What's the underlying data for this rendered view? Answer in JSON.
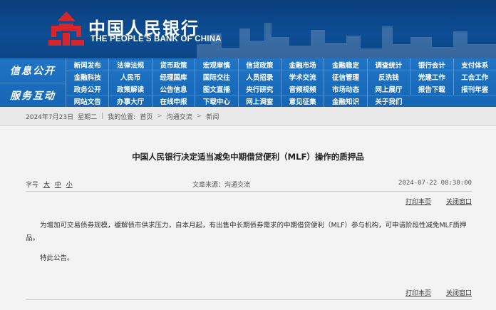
{
  "header": {
    "brand_cn": "中国人民银行",
    "brand_en": "THE PEOPLE'S BANK OF CHINA"
  },
  "nav": {
    "section1": "信息公开",
    "section2": "服务互动",
    "rows": [
      [
        "新闻发布",
        "法律法规",
        "货币政策",
        "宏观审慎",
        "信贷政策",
        "金融市场",
        "金融稳定",
        "调查统计",
        "银行会计",
        "支付体系"
      ],
      [
        "金融科技",
        "人民币",
        "经理国库",
        "国际交往",
        "人员招录",
        "学术交流",
        "征信管理",
        "反洗钱",
        "党建工作",
        "工会工作"
      ],
      [
        "政务公开",
        "政策解读",
        "公告信息",
        "图文直播",
        "央行研究",
        "音频视频",
        "市场动态",
        "网上展厅",
        "报告下载",
        "报刊年鉴"
      ],
      [
        "网站文告",
        "办事大厅",
        "在线申报",
        "下载中心",
        "网上调查",
        "意见征集",
        "金融知识",
        "关于我们"
      ]
    ]
  },
  "breadcrumb": {
    "date": "2024年7月23日",
    "weekday": "星期二",
    "location_label": "我的位置:",
    "items": [
      "首页",
      "沟通交流",
      "新闻"
    ]
  },
  "article": {
    "title": "中国人民银行决定适当减免中期借贷便利（MLF）操作的质押品",
    "font_label": "字号",
    "font_large": "大",
    "font_medium": "中",
    "font_small": "小",
    "source": "文章来源：沟通交流",
    "timestamp": "2024-07-22 08:30:00",
    "print_label": "打印本页",
    "close_label": "关闭窗口",
    "paragraph1": "为增加可交易债券规模，缓解债市供求压力，自本月起，有出售中长期债券需求的中期借贷便利（MLF）参与机构，可申请阶段性减免MLF质押品。",
    "paragraph2": "特此公告。"
  },
  "colors": {
    "banner": "#0d4d93",
    "nav": "#1a6cbb",
    "logo_red": "#d6262b"
  }
}
